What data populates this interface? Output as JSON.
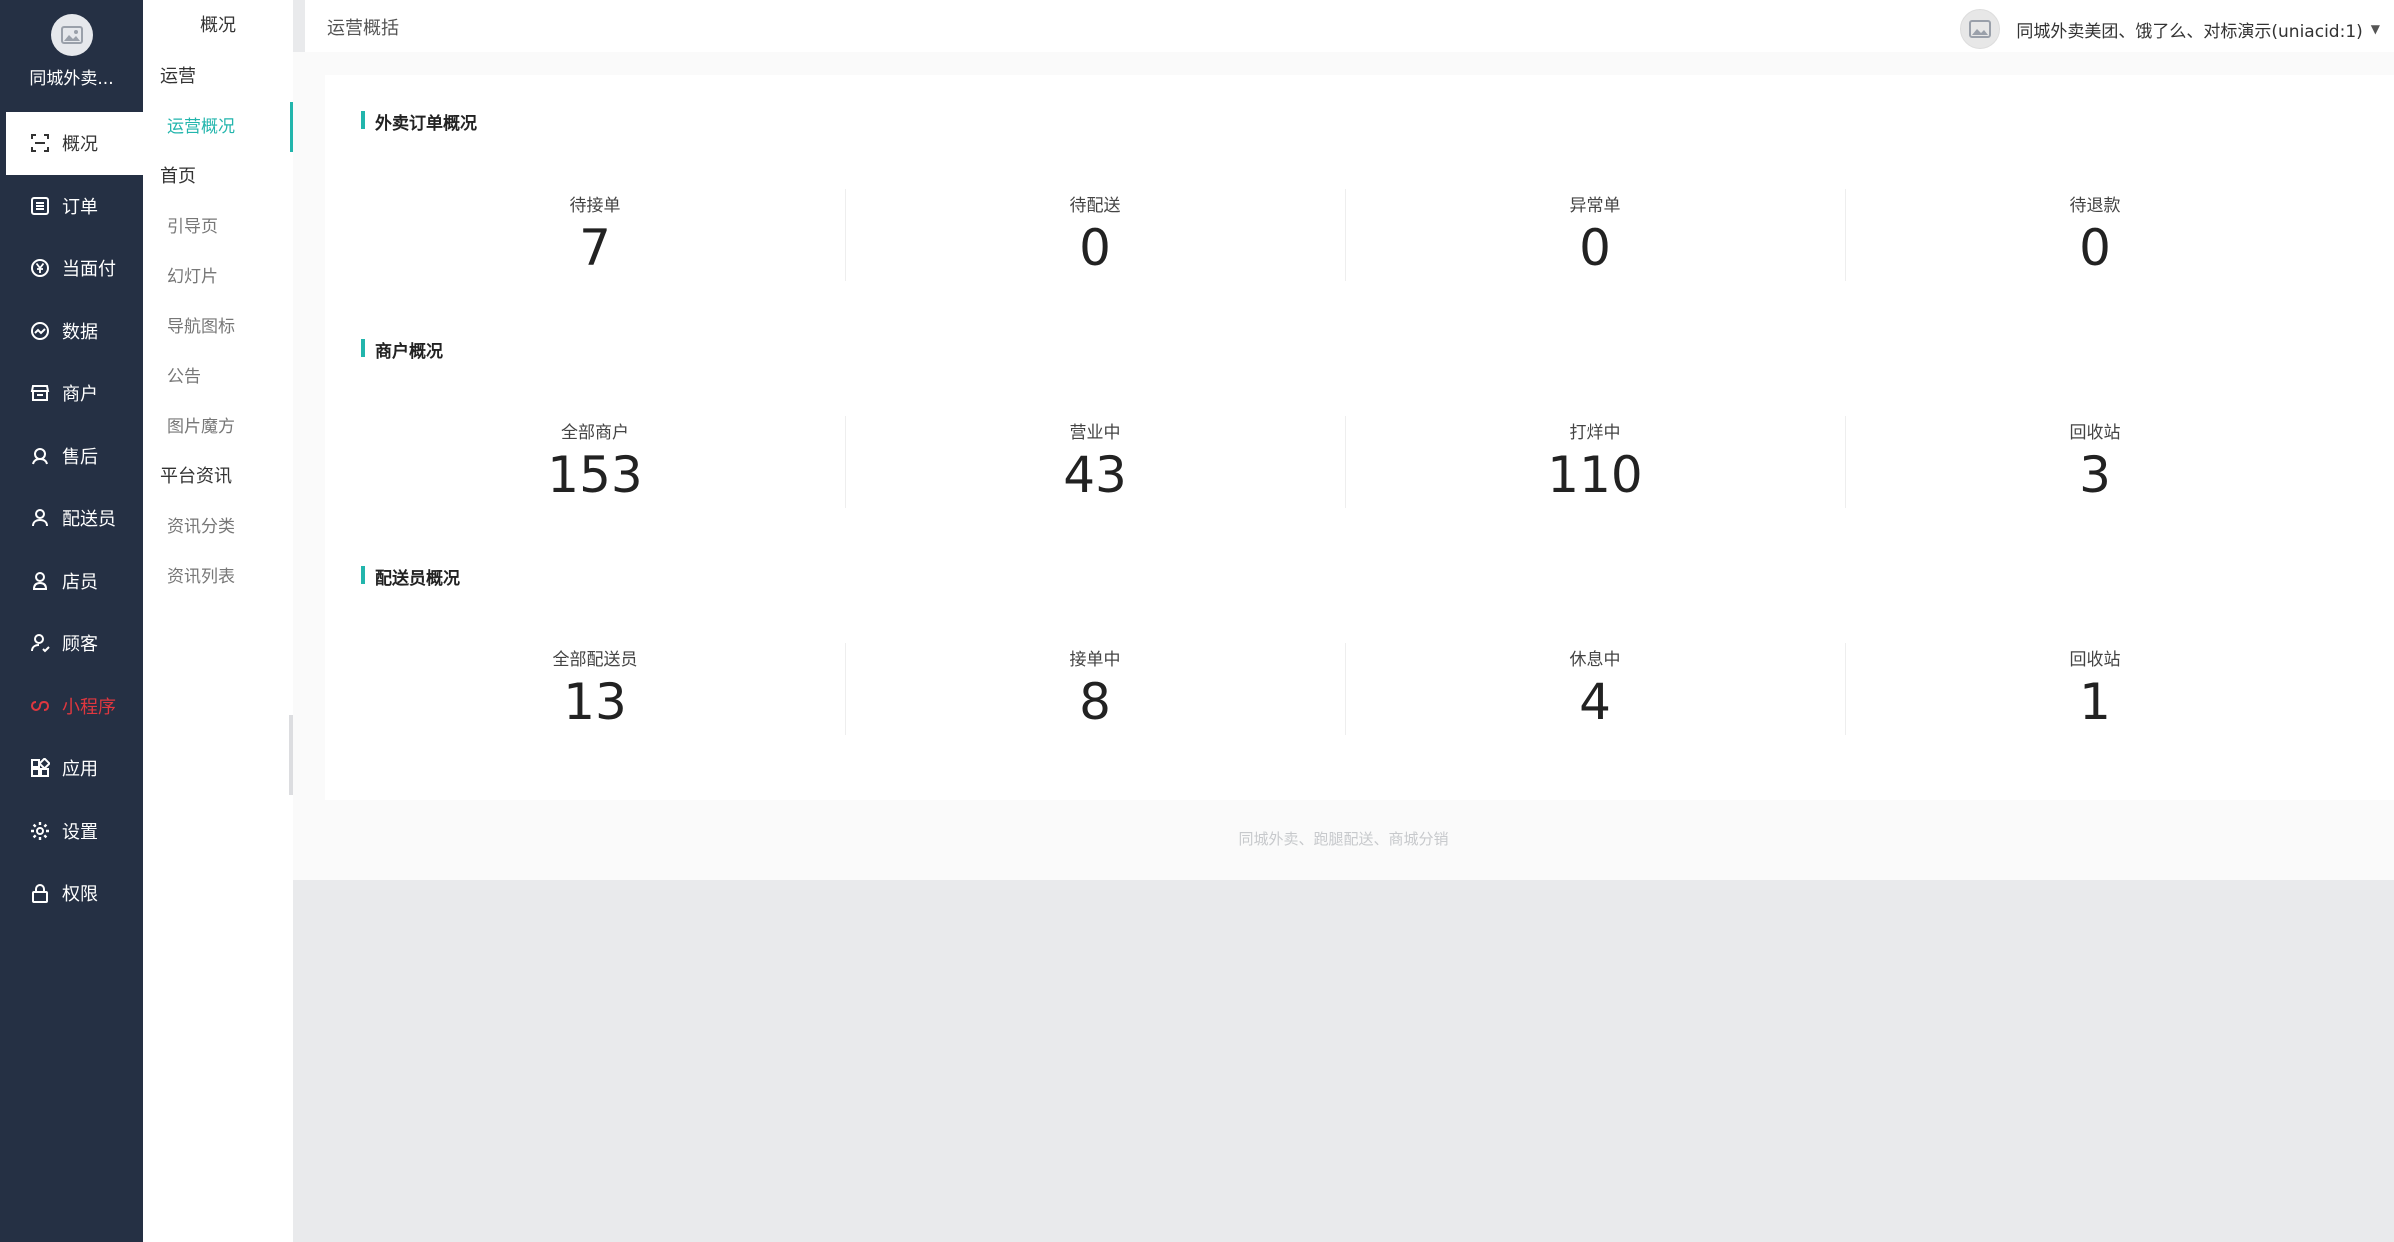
{
  "brand": {
    "name": "同城外卖..."
  },
  "sidebar": {
    "items": [
      {
        "label": "概况",
        "icon": "overview-icon",
        "active": true
      },
      {
        "label": "订单",
        "icon": "order-list-icon"
      },
      {
        "label": "当面付",
        "icon": "yuan-icon"
      },
      {
        "label": "数据",
        "icon": "trend-chart-icon"
      },
      {
        "label": "商户",
        "icon": "store-icon"
      },
      {
        "label": "售后",
        "icon": "aftersale-icon"
      },
      {
        "label": "配送员",
        "icon": "courier-icon"
      },
      {
        "label": "店员",
        "icon": "clerk-icon"
      },
      {
        "label": "顾客",
        "icon": "customer-icon"
      },
      {
        "label": "小程序",
        "icon": "miniprogram-icon"
      },
      {
        "label": "应用",
        "icon": "apps-icon"
      },
      {
        "label": "设置",
        "icon": "gear-icon"
      },
      {
        "label": "权限",
        "icon": "lock-icon"
      }
    ]
  },
  "subnav": {
    "title": "概况",
    "groups": [
      {
        "label": "运营",
        "items": [
          "运营概况"
        ]
      },
      {
        "label": "首页",
        "items": [
          "引导页",
          "幻灯片",
          "导航图标",
          "公告",
          "图片魔方"
        ]
      },
      {
        "label": "平台资讯",
        "items": [
          "资讯分类",
          "资讯列表"
        ]
      }
    ]
  },
  "header": {
    "breadcrumb": "运营概括",
    "user": "同城外卖美团、饿了么、对标演示(uniacid:1)"
  },
  "sections": {
    "orders": {
      "title": "外卖订单概况",
      "stats": [
        {
          "label": "待接单",
          "value": "7"
        },
        {
          "label": "待配送",
          "value": "0"
        },
        {
          "label": "异常单",
          "value": "0"
        },
        {
          "label": "待退款",
          "value": "0"
        }
      ]
    },
    "merchants": {
      "title": "商户概况",
      "stats": [
        {
          "label": "全部商户",
          "value": "153"
        },
        {
          "label": "营业中",
          "value": "43"
        },
        {
          "label": "打烊中",
          "value": "110"
        },
        {
          "label": "回收站",
          "value": "3"
        }
      ]
    },
    "couriers": {
      "title": "配送员概况",
      "stats": [
        {
          "label": "全部配送员",
          "value": "13"
        },
        {
          "label": "接单中",
          "value": "8"
        },
        {
          "label": "休息中",
          "value": "4"
        },
        {
          "label": "回收站",
          "value": "1"
        }
      ]
    }
  },
  "footer": {
    "note": "同城外卖、跑腿配送、商城分销"
  },
  "colors": {
    "sidebar": "#253044",
    "accent": "#22b5ac",
    "alert": "#e0373f"
  }
}
